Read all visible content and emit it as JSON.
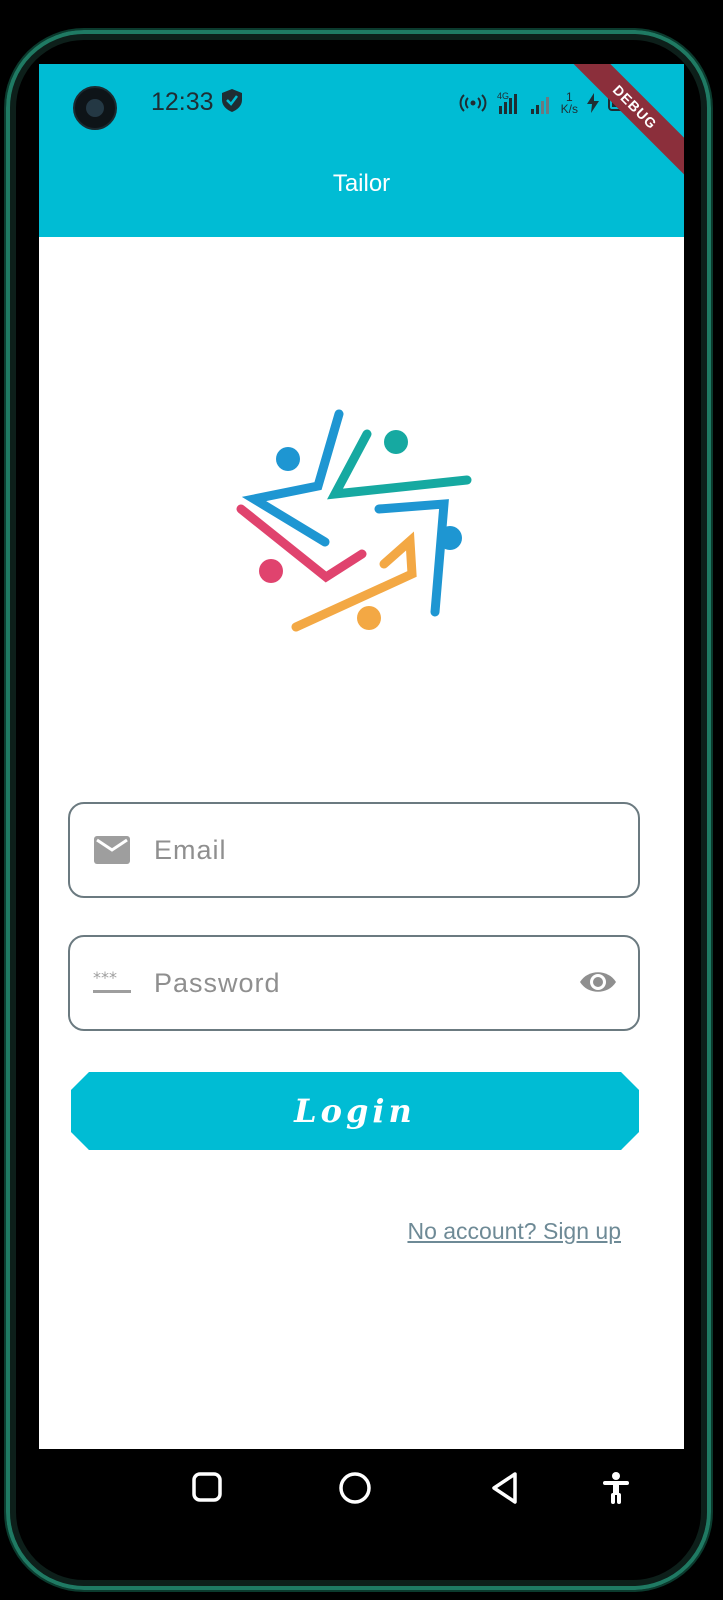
{
  "status_bar": {
    "time": "12:33",
    "network_speed_value": "1",
    "network_speed_unit": "K/s",
    "network_type": "4G"
  },
  "debug_banner": "DEBUG",
  "app_bar": {
    "title": "Tailor"
  },
  "form": {
    "email_placeholder": "Email",
    "password_placeholder": "Password",
    "login_label": "Login",
    "signup_link": "No account? Sign up"
  },
  "icons": {
    "email": "mail-icon",
    "password": "password-dots-icon",
    "visibility": "eye-icon",
    "nav_recents": "square-icon",
    "nav_home": "circle-icon",
    "nav_back": "triangle-back-icon",
    "accessibility": "accessibility-icon"
  },
  "colors": {
    "primary": "#00bcd4",
    "link": "#6e8a96",
    "border": "#6b7a80",
    "debug": "#8b2f3b"
  }
}
